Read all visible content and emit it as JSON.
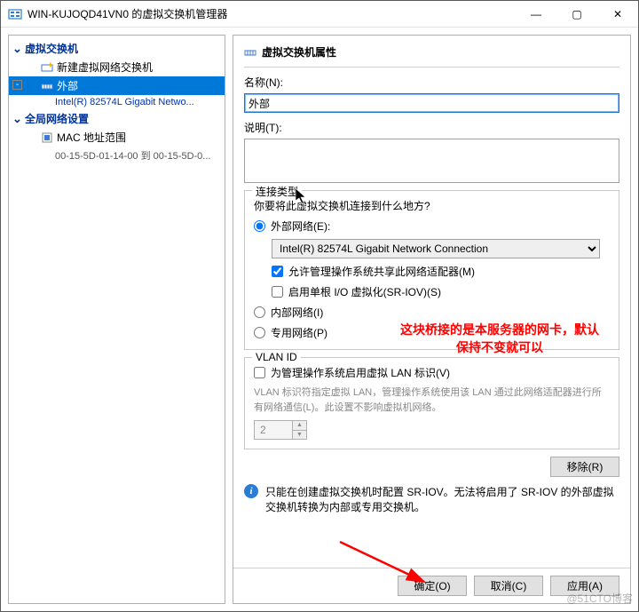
{
  "window": {
    "title": "WIN-KUJOQD41VN0 的虚拟交换机管理器"
  },
  "titlebar_btns": {
    "min": "—",
    "max": "▢",
    "close": "✕"
  },
  "tree": {
    "section_switch": "虚拟交换机",
    "item_new": "新建虚拟网络交换机",
    "item_external": "外部",
    "item_external_sub": "Intel(R) 82574L Gigabit Netwo...",
    "section_global": "全局网络设置",
    "item_mac": "MAC 地址范围",
    "item_mac_sub": "00-15-5D-01-14-00 到 00-15-5D-0..."
  },
  "panel": {
    "header": "虚拟交换机属性",
    "name_label": "名称(N):",
    "name_value": "外部",
    "desc_label": "说明(T):",
    "desc_value": ""
  },
  "conn": {
    "legend": "连接类型",
    "question": "你要将此虚拟交换机连接到什么地方?",
    "radio_external": "外部网络(E):",
    "adapter_selected": "Intel(R) 82574L Gigabit Network Connection",
    "chk_share": "允许管理操作系统共享此网络适配器(M)",
    "chk_sriov": "启用单根 I/O 虚拟化(SR-IOV)(S)",
    "radio_internal": "内部网络(I)",
    "radio_private": "专用网络(P)"
  },
  "vlan": {
    "legend": "VLAN ID",
    "chk_enable": "为管理操作系统启用虚拟 LAN 标识(V)",
    "hint": "VLAN 标识符指定虚拟 LAN，管理操作系统使用该 LAN 通过此网络适配器进行所有网络通信(L)。此设置不影响虚拟机网络。",
    "value": "2"
  },
  "remove_btn": "移除(R)",
  "info_text": "只能在创建虚拟交换机时配置 SR-IOV。无法将启用了 SR-IOV 的外部虚拟交换机转换为内部或专用交换机。",
  "footer": {
    "ok": "确定(O)",
    "cancel": "取消(C)",
    "apply": "应用(A)"
  },
  "annotation": {
    "line1": "这块桥接的是本服务器的网卡，默认",
    "line2": "保持不变就可以"
  },
  "watermark": "@51CTO博客"
}
